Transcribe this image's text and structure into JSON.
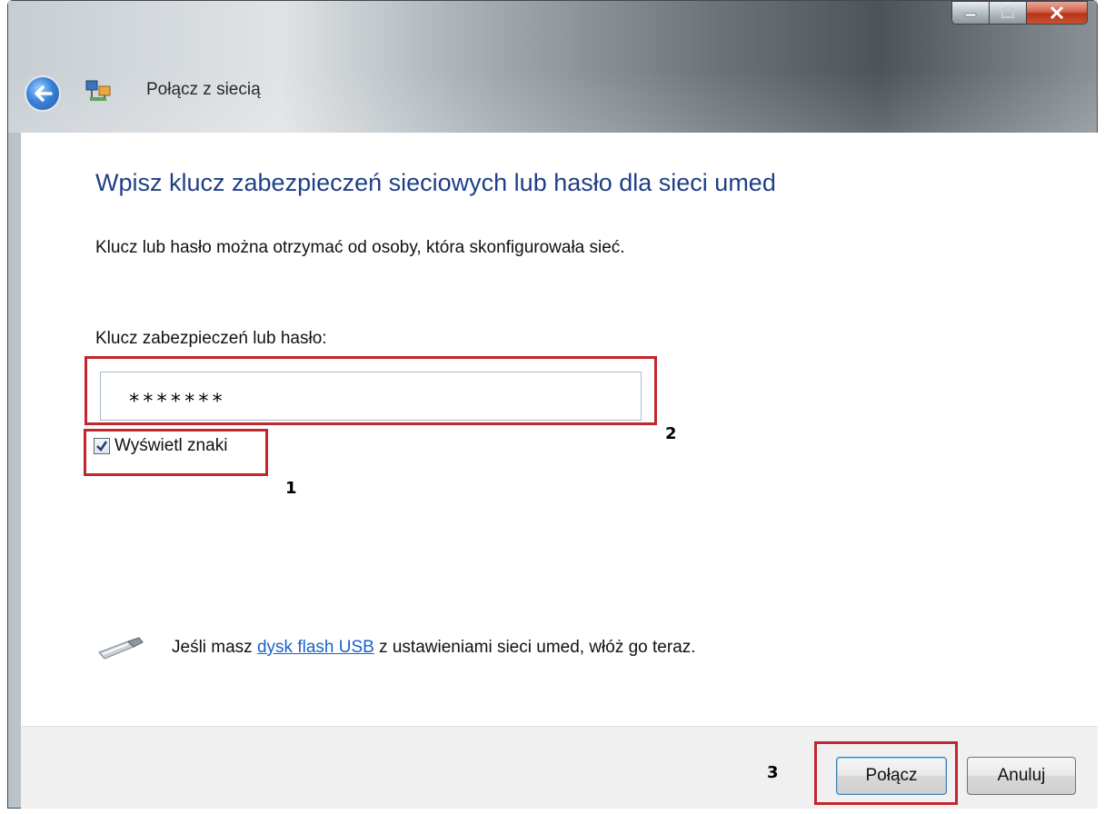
{
  "window": {
    "title": "Połącz z siecią",
    "controls": {
      "minimize_icon": "minimize-icon",
      "maximize_icon": "maximize-icon",
      "close_icon": "close-icon"
    }
  },
  "content": {
    "heading": "Wpisz klucz zabezpieczeń sieciowych lub hasło dla sieci umed",
    "instruction": "Klucz lub hasło można otrzymać od osoby, która skonfigurowała sieć.",
    "key_label": "Klucz zabezpieczeń lub hasło:",
    "password_value": "*******",
    "show_chars": {
      "label": "Wyświetl znaki",
      "checked": true
    },
    "usb": {
      "text_before": "Jeśli masz ",
      "link": "dysk flash USB",
      "text_after": " z ustawieniami sieci umed, włóż go teraz."
    }
  },
  "annotations": {
    "one": "1",
    "two": "2",
    "three": "3"
  },
  "footer": {
    "connect_label": "Połącz",
    "cancel_label": "Anuluj"
  },
  "colors": {
    "heading": "#1e3f86",
    "link": "#1863c6",
    "highlight": "#c2262e"
  }
}
